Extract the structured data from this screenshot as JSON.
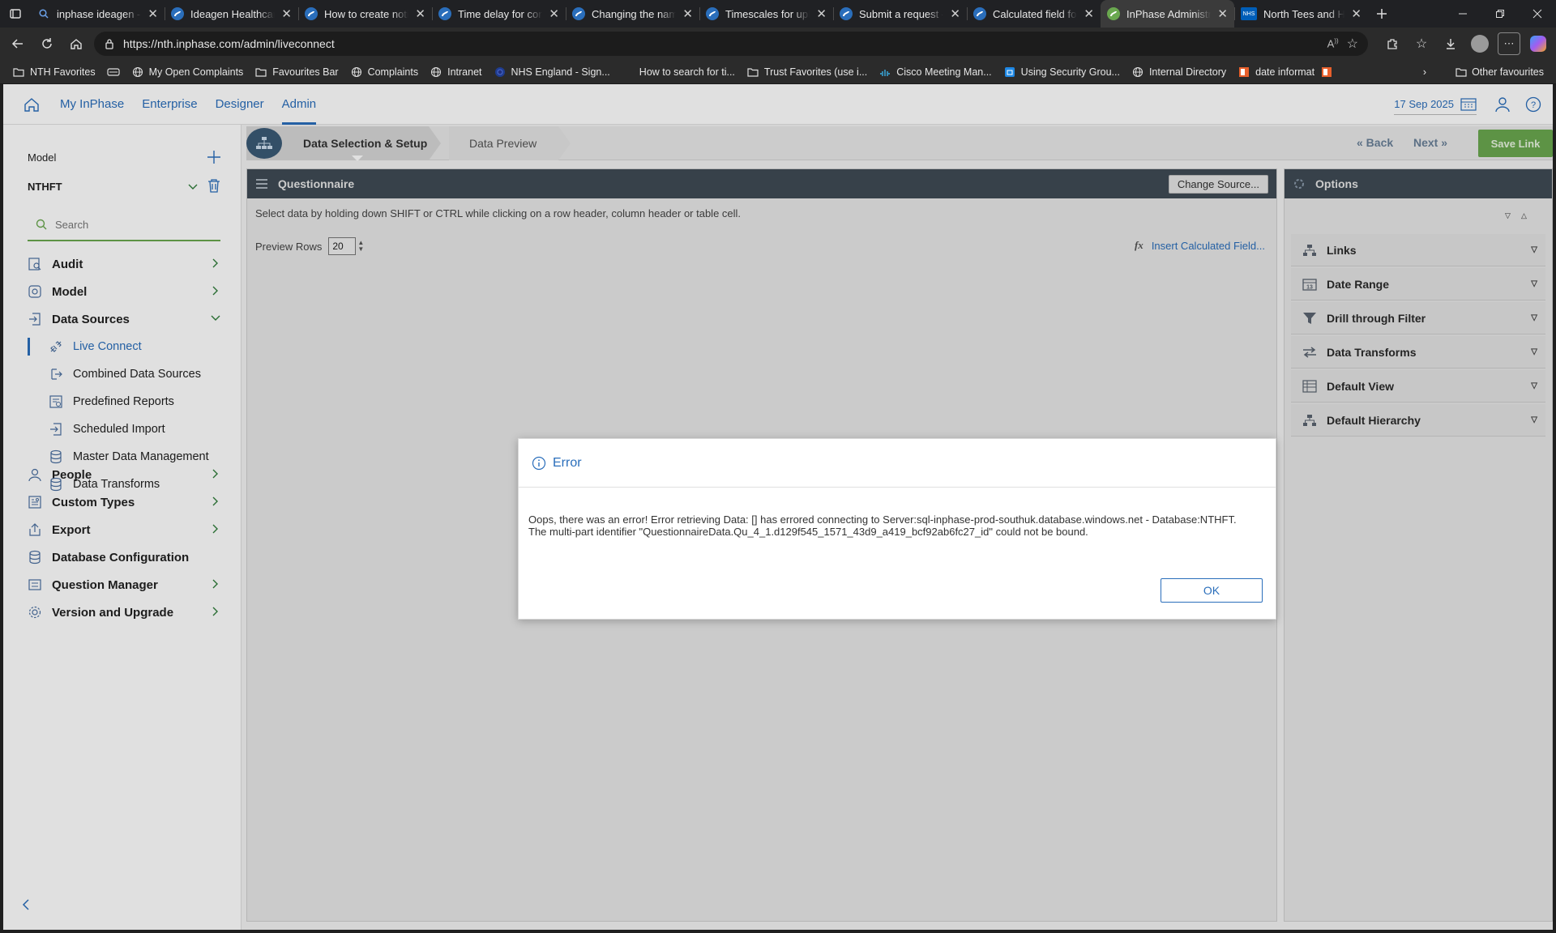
{
  "browser": {
    "tabs": [
      {
        "title": "inphase ideagen - S",
        "icon": "search-icon",
        "color": "#2a6ebb"
      },
      {
        "title": "Ideagen Healthcare",
        "icon": "ideagen-icon",
        "color": "#2a6ebb"
      },
      {
        "title": "How to create notif",
        "icon": "ideagen-icon",
        "color": "#2a6ebb"
      },
      {
        "title": "Time delay for com",
        "icon": "ideagen-icon",
        "color": "#2a6ebb"
      },
      {
        "title": "Changing the name",
        "icon": "ideagen-icon",
        "color": "#2a6ebb"
      },
      {
        "title": "Timescales for uplo",
        "icon": "ideagen-icon",
        "color": "#2a6ebb"
      },
      {
        "title": "Submit a request –",
        "icon": "ideagen-icon",
        "color": "#2a6ebb"
      },
      {
        "title": "Calculated field for",
        "icon": "ideagen-icon",
        "color": "#2a6ebb"
      },
      {
        "title": "InPhase Administra",
        "icon": "inphase-icon",
        "color": "#6aa84f",
        "active": true
      },
      {
        "title": "North Tees and Har",
        "icon": "nhs-icon",
        "color": "#005eb8"
      }
    ],
    "url": "https://nth.inphase.com/admin/liveconnect",
    "favourites": [
      {
        "label": "NTH Favorites",
        "icon": "folder-icon"
      },
      {
        "label": "",
        "icon": "card-icon"
      },
      {
        "label": "My Open Complaints",
        "icon": "globe-icon"
      },
      {
        "label": "Favourites Bar",
        "icon": "folder-icon"
      },
      {
        "label": "Complaints",
        "icon": "globe-icon"
      },
      {
        "label": "Intranet",
        "icon": "globe-icon"
      },
      {
        "label": "NHS England - Sign...",
        "icon": "nhs-circle-icon"
      },
      {
        "label": "How to search for ti...",
        "icon": "blank-icon"
      },
      {
        "label": "Trust Favorites (use i...",
        "icon": "folder-icon"
      },
      {
        "label": "Cisco Meeting Man...",
        "icon": "cisco-icon"
      },
      {
        "label": "Using Security Grou...",
        "icon": "azure-icon"
      },
      {
        "label": "Internal Directory",
        "icon": "globe-icon"
      },
      {
        "label": "date informat",
        "icon": "office-icon"
      }
    ],
    "other_favourites": "Other favourites"
  },
  "topnav": {
    "items": [
      "My InPhase",
      "Enterprise",
      "Designer",
      "Admin"
    ],
    "active": "Admin",
    "date": "17 Sep 2025"
  },
  "sidebar": {
    "model_label": "Model",
    "model_value": "NTHFT",
    "search_placeholder": "Search",
    "items": [
      {
        "label": "Audit",
        "icon": "audit-icon"
      },
      {
        "label": "Model",
        "icon": "model-icon"
      },
      {
        "label": "Data Sources",
        "icon": "data-sources-icon",
        "expanded": true
      },
      {
        "label": "People",
        "icon": "person-icon"
      },
      {
        "label": "Custom Types",
        "icon": "custom-types-icon"
      },
      {
        "label": "Export",
        "icon": "export-icon"
      },
      {
        "label": "Database Configuration",
        "icon": "database-icon"
      },
      {
        "label": "Question Manager",
        "icon": "question-manager-icon"
      },
      {
        "label": "Version and Upgrade",
        "icon": "gear-icon"
      }
    ],
    "sub_items": [
      {
        "label": "Live Connect",
        "icon": "live-connect-icon",
        "active": true
      },
      {
        "label": "Combined Data Sources",
        "icon": "combined-icon"
      },
      {
        "label": "Predefined Reports",
        "icon": "report-icon"
      },
      {
        "label": "Scheduled Import",
        "icon": "import-icon"
      },
      {
        "label": "Master Data Management",
        "icon": "database-icon"
      },
      {
        "label": "Data Transforms",
        "icon": "database-icon"
      }
    ]
  },
  "wizard": {
    "step1": "Data Selection & Setup",
    "step2": "Data Preview",
    "back": "« Back",
    "next": "Next »",
    "save": "Save Link"
  },
  "questionnaire": {
    "title": "Questionnaire",
    "change_source": "Change Source...",
    "instructions": "Select data by holding down SHIFT or CTRL while clicking on a row header, column header or table cell.",
    "preview_rows_label": "Preview Rows",
    "preview_rows_value": "20",
    "calc_field_label": "Insert Calculated Field...",
    "fx": "fx"
  },
  "options": {
    "title": "Options",
    "items": [
      {
        "label": "Links",
        "icon": "links-icon"
      },
      {
        "label": "Date Range",
        "icon": "calendar-icon"
      },
      {
        "label": "Drill through Filter",
        "icon": "filter-icon"
      },
      {
        "label": "Data Transforms",
        "icon": "transforms-icon"
      },
      {
        "label": "Default View",
        "icon": "view-icon"
      },
      {
        "label": "Default Hierarchy",
        "icon": "hierarchy-icon"
      }
    ]
  },
  "modal": {
    "title": "Error",
    "message_line1": "Oops, there was an error! Error retrieving Data: [] has errored connecting to Server:sql-inphase-prod-southuk.database.windows.net - Database:NTHFT.",
    "message_line2": "The multi-part identifier \"QuestionnaireData.Qu_4_1.d129f545_1571_43d9_a419_bcf92ab6fc27_id\" could not be bound.",
    "ok": "OK"
  },
  "colors": {
    "accent": "#2a6ebb",
    "save_green": "#6aa84f",
    "panel_header": "#3f4a55"
  }
}
